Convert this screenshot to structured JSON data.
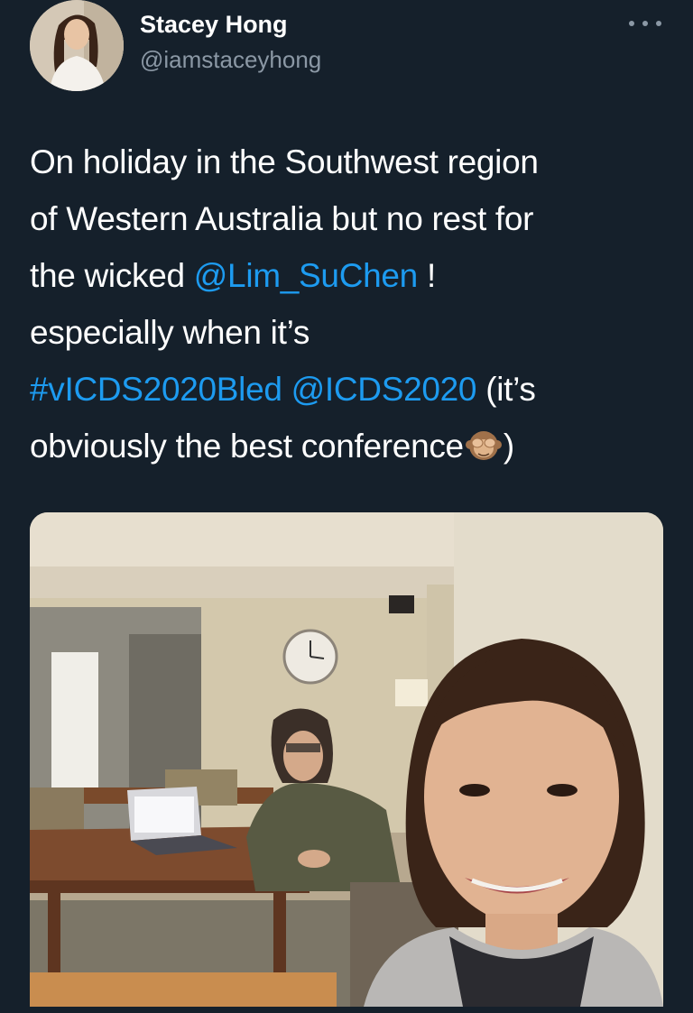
{
  "tweet": {
    "author": {
      "name": "Stacey Hong",
      "handle": "@iamstaceyhong"
    },
    "text_lines": {
      "l1": "On holiday in the Southwest region",
      "l2": "of Western Australia but no rest for",
      "l3_before": "the wicked ",
      "l3_mention": "@Lim_SuChen",
      "l3_after": " !",
      "l4": "especially when it’s",
      "l5_hashtag": "#vICDS2020Bled",
      "l5_space": " ",
      "l5_mention": "@ICDS2020",
      "l5_after": " (it’s",
      "l6_before": "obviously the best conference",
      "l6_after": ")"
    },
    "emoji": "see-no-evil-monkey-icon"
  },
  "colors": {
    "background": "#15202b",
    "link": "#1d9bf0",
    "secondary_text": "#8b98a5"
  }
}
